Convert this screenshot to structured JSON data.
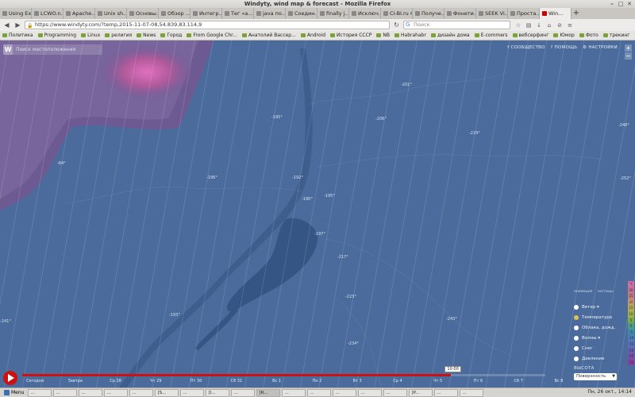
{
  "window": {
    "title": "Windyty, wind map & forecast - Mozilla Firefox"
  },
  "tabs": [
    {
      "label": "Using Expr..."
    },
    {
      "label": "LCWO.n..."
    },
    {
      "label": "Apache..."
    },
    {
      "label": "Unix sh..."
    },
    {
      "label": "Основы..."
    },
    {
      "label": "Обзор ..."
    },
    {
      "label": "Интегр..."
    },
    {
      "label": "Тег «а..."
    },
    {
      "label": "java по..."
    },
    {
      "label": "Соедин..."
    },
    {
      "label": "finally j..."
    },
    {
      "label": "Исключ..."
    },
    {
      "label": "CI-BI.ru Фо..."
    },
    {
      "label": "Получе..."
    },
    {
      "label": "Фонети..."
    },
    {
      "label": "SEEK Vi..."
    },
    {
      "label": "Проста..."
    },
    {
      "label": "Win..."
    }
  ],
  "nav": {
    "url": "https://www.windyty.com/?temp,2015-11-07-08,54.839,83.114,9",
    "search_placeholder": "Поиск"
  },
  "bookmarks": [
    "Политика",
    "Programming",
    "Linux",
    "религия",
    "News",
    "Город",
    "From Google Chr...",
    "Анатолий Вассер...",
    "Android",
    "История СССР",
    "NB",
    "Habrahabr",
    "дизайн дома",
    "E-commers",
    "вебсерфинг",
    "Юмор",
    "Фото",
    "трекинг"
  ],
  "map": {
    "search_placeholder": "Поиск местоположения",
    "top_links": {
      "community": "СООБЩЕСТВО",
      "help": "ПОМОЩЬ",
      "settings": "НАСТРОЙКИ"
    },
    "zoom_in": "+",
    "zoom_out": "−",
    "temps": [
      "-201°",
      "-206°",
      "-195°",
      "-84°",
      "-196°",
      "-192°",
      "-190°",
      "-195°",
      "-197°",
      "-217°",
      "-223°",
      "-193°",
      "-243°",
      "-234°",
      "-241°",
      "-229°",
      "-248°",
      "-252°"
    ],
    "toggles": {
      "animate": "анимация",
      "rain": "частицы"
    },
    "layers": [
      {
        "label": "Ветер ▾",
        "active": false
      },
      {
        "label": "Температура",
        "active": true
      },
      {
        "label": "Облака, дожд.",
        "active": false
      },
      {
        "label": "Волны ▾",
        "active": false
      },
      {
        "label": "Снег",
        "active": false
      },
      {
        "label": "Давление",
        "active": false
      }
    ],
    "scale": [
      "°C",
      "30",
      "25",
      "20",
      "15",
      "10",
      "5",
      "0",
      "-5",
      "-10",
      "-15",
      "-20",
      "-25",
      "-30"
    ],
    "scale_colors": [
      "#d070a0",
      "#c87090",
      "#c47b7b",
      "#c89a6a",
      "#b9a84f",
      "#9fb04a",
      "#79a846",
      "#4b9a8a",
      "#3d8aa8",
      "#4a7db8",
      "#5a6eb8",
      "#6a5eb0",
      "#7a4fa8",
      "#8a3fa0"
    ],
    "height_label": "ВЫСОТА",
    "height_value": "Поверхность",
    "timeline": {
      "current": "10:00",
      "progress": 0.82,
      "days": [
        "Сегодня",
        "Завтра",
        "Ср 28",
        "Чт 29",
        "Пт 30",
        "Сб 31",
        "Вс 1",
        "Пн 2",
        "Вт 3",
        "Ср 4",
        "Чт 5",
        "Пт 6",
        "Сб 7",
        "Вс 8"
      ]
    }
  },
  "taskbar": {
    "menu": "Menu",
    "items": [
      "...",
      "...",
      "...",
      "...",
      "...",
      "[S...",
      "...",
      "[I...",
      "...",
      "[R...",
      "...",
      "...",
      "...",
      "...",
      "...",
      "[P...",
      "...",
      "..."
    ],
    "clock": "Пн, 26 окт., 14:14"
  }
}
